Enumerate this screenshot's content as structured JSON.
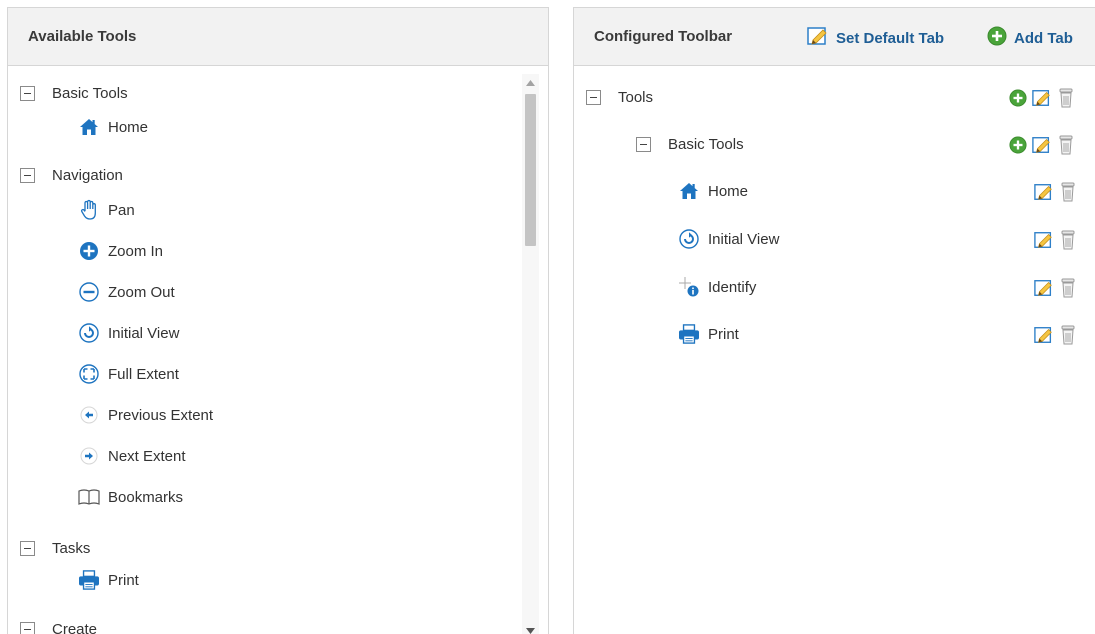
{
  "left_panel": {
    "title": "Available Tools",
    "groups": [
      {
        "label": "Basic Tools",
        "items": [
          {
            "label": "Home",
            "icon": "home-icon"
          }
        ]
      },
      {
        "label": "Navigation",
        "items": [
          {
            "label": "Pan",
            "icon": "pan-hand-icon"
          },
          {
            "label": "Zoom In",
            "icon": "zoom-in-icon"
          },
          {
            "label": "Zoom Out",
            "icon": "zoom-out-icon"
          },
          {
            "label": "Initial View",
            "icon": "initial-view-icon"
          },
          {
            "label": "Full Extent",
            "icon": "full-extent-icon"
          },
          {
            "label": "Previous Extent",
            "icon": "previous-extent-icon"
          },
          {
            "label": "Next Extent",
            "icon": "next-extent-icon"
          },
          {
            "label": "Bookmarks",
            "icon": "bookmarks-icon"
          }
        ]
      },
      {
        "label": "Tasks",
        "items": [
          {
            "label": "Print",
            "icon": "print-icon"
          }
        ]
      },
      {
        "label": "Create",
        "items": []
      }
    ]
  },
  "right_panel": {
    "title": "Configured Toolbar",
    "set_default_tab": "Set Default Tab",
    "add_tab": "Add Tab",
    "tree": {
      "root": "Tools",
      "group": "Basic Tools",
      "items": [
        {
          "label": "Home",
          "icon": "home-icon"
        },
        {
          "label": "Initial View",
          "icon": "initial-view-icon"
        },
        {
          "label": "Identify",
          "icon": "identify-icon"
        },
        {
          "label": "Print",
          "icon": "print-icon"
        }
      ]
    }
  },
  "colors": {
    "link": "#1f5e95",
    "icon_blue": "#1e74c0",
    "add_green": "#4aa43a",
    "header_bg": "#f2f2f2",
    "border": "#d6d6d6"
  }
}
